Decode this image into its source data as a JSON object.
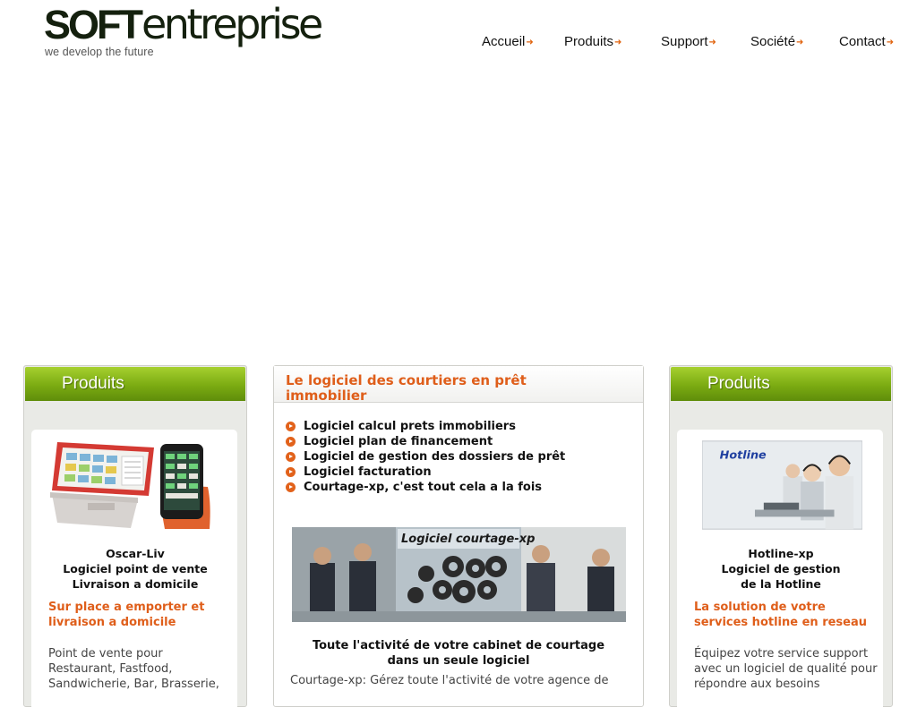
{
  "logo": {
    "soft": "SOFT",
    "entreprise": "entreprise",
    "tagline": "we develop the future"
  },
  "nav": {
    "items": [
      {
        "label": "Accueil"
      },
      {
        "label": "Produits"
      },
      {
        "label": "Support"
      },
      {
        "label": "Société"
      },
      {
        "label": "Contact"
      }
    ],
    "arrow": "➜"
  },
  "left_box": {
    "header": "Produits",
    "product": {
      "title_lines": [
        "Oscar-Liv",
        "Logiciel point de vente",
        "Livraison a domicile"
      ],
      "tagline": "Sur place a emporter et livraison a domicile",
      "description": "Point de vente pour Restaurant, Fastfood, Sandwicherie, Bar, Brasserie,"
    }
  },
  "center_box": {
    "title": "Le logiciel des courtiers en prêt immobilier",
    "list": [
      "Logiciel calcul prets immobiliers",
      "Logiciel plan de financement",
      "Logiciel de gestion des dossiers de prêt",
      "Logiciel facturation",
      "Courtage-xp, c'est tout cela a la fois"
    ],
    "image_label": "Logiciel courtage-xp",
    "caption_lines": [
      "Toute l'activité de votre cabinet de courtage",
      "dans un seule logiciel"
    ],
    "text": "Courtage-xp: Gérez toute l'activité de votre agence de"
  },
  "right_box": {
    "header": "Produits",
    "product": {
      "image_label": "Hotline",
      "title_lines": [
        "Hotline-xp",
        "Logiciel de gestion",
        "de la Hotline"
      ],
      "tagline": "La solution de votre services hotline en reseau",
      "description": "Équipez votre service support avec un logiciel de qualité pour répondre aux besoins"
    }
  },
  "colors": {
    "accent_orange": "#df5e1a",
    "header_green": "#7bab12",
    "logo_dark": "#14200e"
  }
}
